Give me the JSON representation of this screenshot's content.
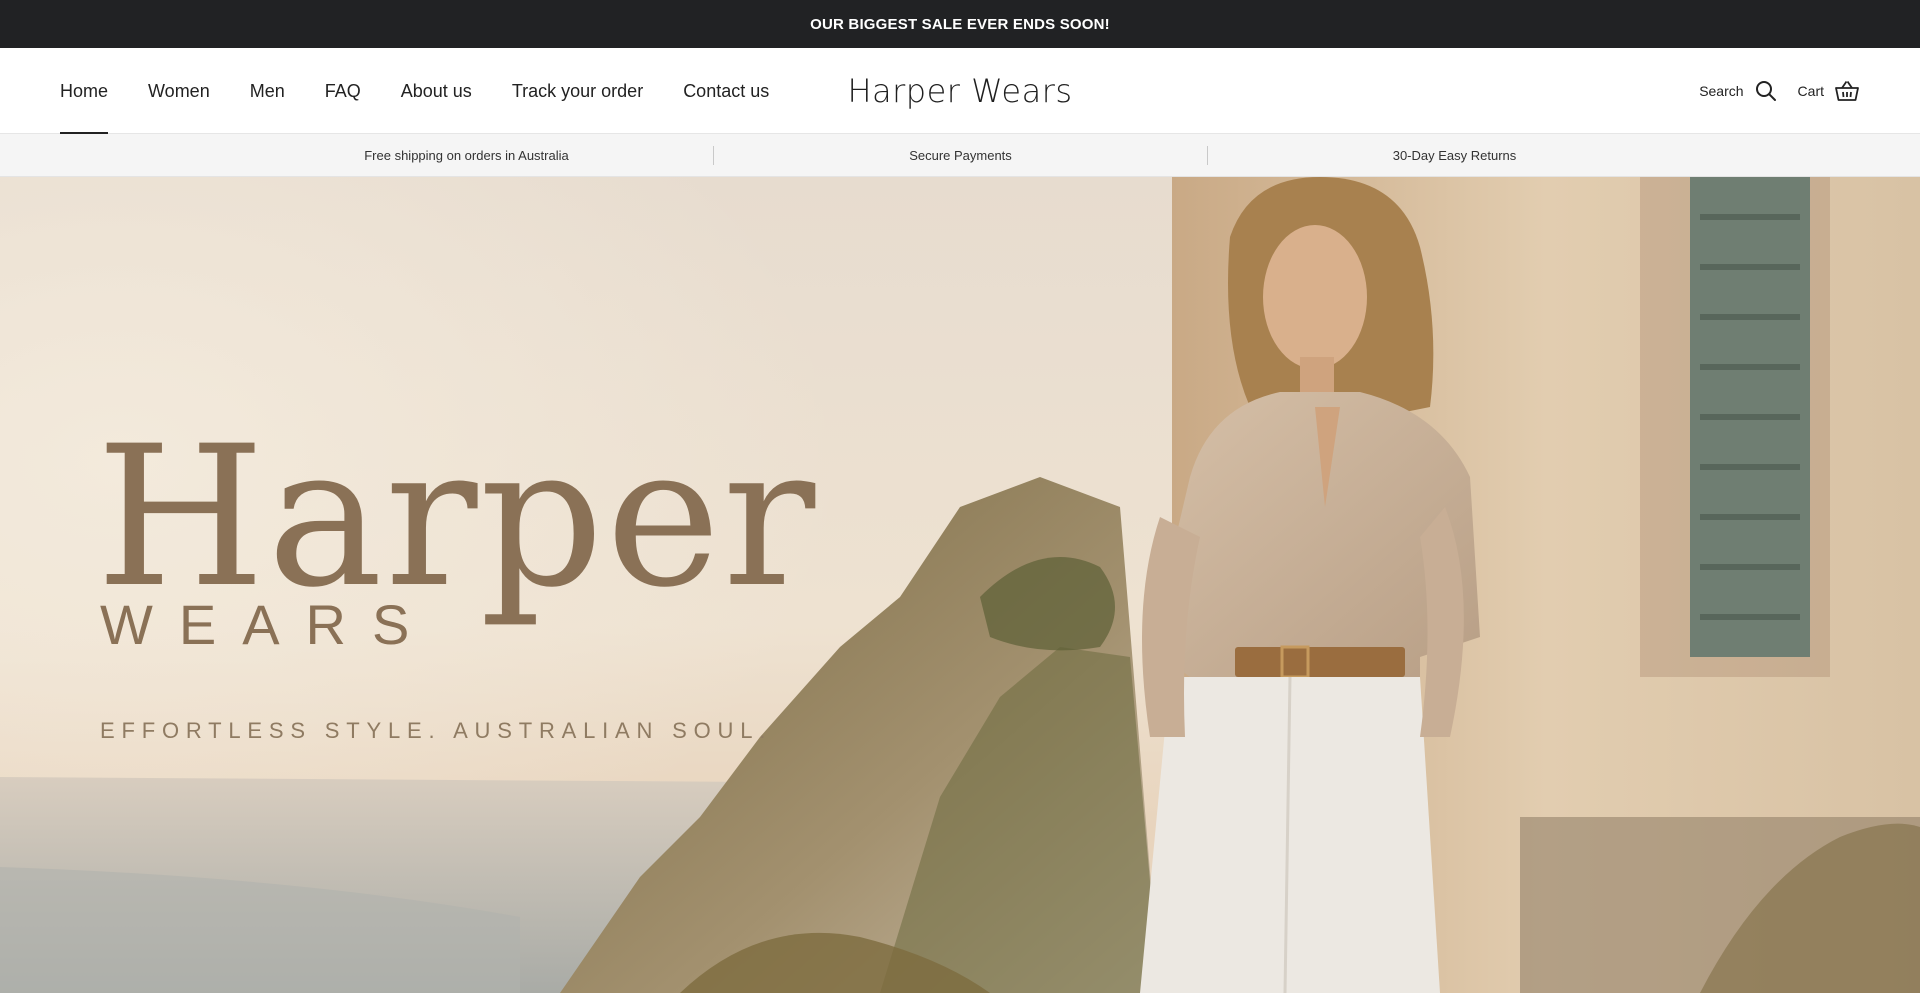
{
  "announcement": {
    "text": "OUR BIGGEST SALE EVER ENDS SOON!"
  },
  "nav": {
    "items": [
      {
        "label": "Home",
        "active": true
      },
      {
        "label": "Women"
      },
      {
        "label": "Men"
      },
      {
        "label": "FAQ"
      },
      {
        "label": "About us"
      },
      {
        "label": "Track your order"
      },
      {
        "label": "Contact us"
      }
    ]
  },
  "brand": {
    "name": "Harper Wears"
  },
  "tools": {
    "search_label": "Search",
    "cart_label": "Cart",
    "search_icon": "search-icon",
    "cart_icon": "basket-icon"
  },
  "usp": {
    "items": [
      "Free shipping on orders in Australia",
      "Secure Payments",
      "30-Day Easy Returns"
    ]
  },
  "hero": {
    "title": "Harper",
    "subtitle": "WEARS",
    "tagline": "EFFORTLESS STYLE. AUSTRALIAN SOUL.",
    "colors": {
      "text": "#8a7156",
      "sky": "#e9ddcf",
      "sea": "#b9b8b2",
      "wall": "#d9c3a4",
      "shirt": "#c9b19a",
      "pants": "#ece8e2"
    }
  },
  "theme": {
    "announcement_bg": "#212224",
    "usp_bg": "#f5f5f5"
  }
}
